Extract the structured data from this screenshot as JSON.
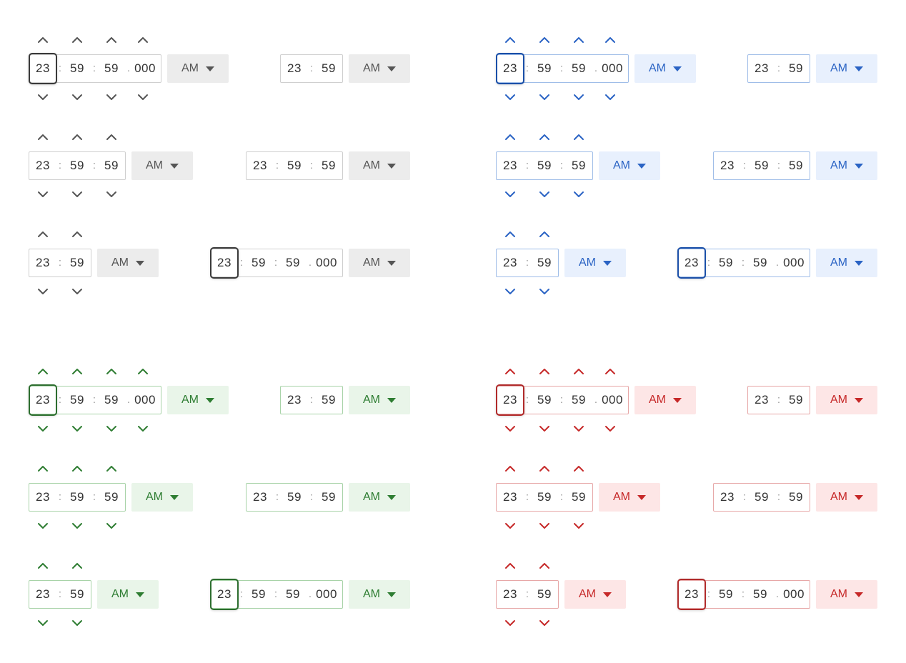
{
  "segments": {
    "hours": "23",
    "minutes": "59",
    "seconds": "59",
    "milliseconds": "000",
    "colon": ":",
    "dot": "."
  },
  "meridiem": {
    "selected": "AM"
  },
  "themes": {
    "neutral": {
      "accent": "#555555",
      "border": "#cfcfcf",
      "fill": "#ececec"
    },
    "blue": {
      "accent": "#2a63c4",
      "border": "#9fbde8",
      "fill": "#e8f0fd"
    },
    "green": {
      "accent": "#2e7d32",
      "border": "#a8d3a8",
      "fill": "#e9f5e9"
    },
    "red": {
      "accent": "#c62828",
      "border": "#e7a7a7",
      "fill": "#fde6e6"
    }
  },
  "icons": {
    "increment": "chevron-up-icon",
    "decrement": "chevron-down-icon",
    "dropdown": "caret-down-icon"
  },
  "pickers": [
    {
      "theme": "neutral",
      "format": "hh:mm:ss.SSS",
      "spinners": true,
      "focused": true
    },
    {
      "theme": "neutral",
      "format": "hh:mm",
      "spinners": false,
      "focused": false
    },
    {
      "theme": "neutral",
      "format": "hh:mm:ss",
      "spinners": true,
      "focused": false
    },
    {
      "theme": "neutral",
      "format": "hh:mm:ss",
      "spinners": false,
      "focused": false
    },
    {
      "theme": "neutral",
      "format": "hh:mm",
      "spinners": true,
      "focused": false
    },
    {
      "theme": "neutral",
      "format": "hh:mm:ss.SSS",
      "spinners": false,
      "focused": true
    },
    {
      "theme": "blue",
      "format": "hh:mm:ss.SSS",
      "spinners": true,
      "focused": true
    },
    {
      "theme": "blue",
      "format": "hh:mm",
      "spinners": false,
      "focused": false
    },
    {
      "theme": "blue",
      "format": "hh:mm:ss",
      "spinners": true,
      "focused": false
    },
    {
      "theme": "blue",
      "format": "hh:mm:ss",
      "spinners": false,
      "focused": false
    },
    {
      "theme": "blue",
      "format": "hh:mm",
      "spinners": true,
      "focused": false
    },
    {
      "theme": "blue",
      "format": "hh:mm:ss.SSS",
      "spinners": false,
      "focused": true
    },
    {
      "theme": "green",
      "format": "hh:mm:ss.SSS",
      "spinners": true,
      "focused": true
    },
    {
      "theme": "green",
      "format": "hh:mm",
      "spinners": false,
      "focused": false
    },
    {
      "theme": "green",
      "format": "hh:mm:ss",
      "spinners": true,
      "focused": false
    },
    {
      "theme": "green",
      "format": "hh:mm:ss",
      "spinners": false,
      "focused": false
    },
    {
      "theme": "green",
      "format": "hh:mm",
      "spinners": true,
      "focused": false
    },
    {
      "theme": "green",
      "format": "hh:mm:ss.SSS",
      "spinners": false,
      "focused": true
    },
    {
      "theme": "red",
      "format": "hh:mm:ss.SSS",
      "spinners": true,
      "focused": true
    },
    {
      "theme": "red",
      "format": "hh:mm",
      "spinners": false,
      "focused": false
    },
    {
      "theme": "red",
      "format": "hh:mm:ss",
      "spinners": true,
      "focused": false
    },
    {
      "theme": "red",
      "format": "hh:mm:ss",
      "spinners": false,
      "focused": false
    },
    {
      "theme": "red",
      "format": "hh:mm",
      "spinners": true,
      "focused": false
    },
    {
      "theme": "red",
      "format": "hh:mm:ss.SSS",
      "spinners": false,
      "focused": true
    }
  ]
}
